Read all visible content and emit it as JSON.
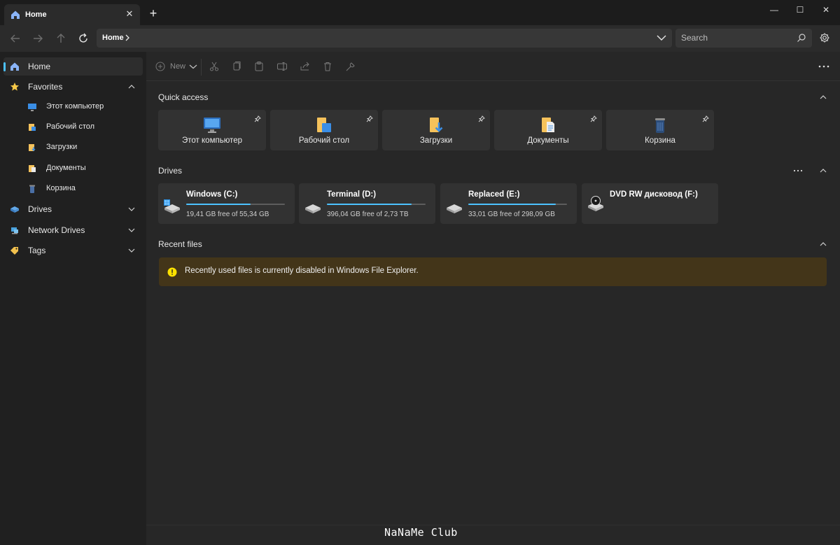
{
  "tab": {
    "title": "Home",
    "close": "✕",
    "new_tab": "+"
  },
  "window_controls": {
    "minimize": "—",
    "maximize": "☐",
    "close": "✕"
  },
  "address": {
    "crumb": "Home"
  },
  "search": {
    "placeholder": "Search"
  },
  "sidebar": {
    "items": [
      {
        "label": "Home",
        "icon": "home-icon",
        "active": true
      },
      {
        "label": "Favorites",
        "icon": "star-icon",
        "expanded": true
      },
      {
        "label": "Этот компьютер",
        "icon": "monitor-icon"
      },
      {
        "label": "Рабочий стол",
        "icon": "folder-icon"
      },
      {
        "label": "Загрузки",
        "icon": "folder-icon"
      },
      {
        "label": "Документы",
        "icon": "document-icon"
      },
      {
        "label": "Корзина",
        "icon": "recycle-bin-icon"
      },
      {
        "label": "Drives",
        "icon": "drive-icon",
        "expanded": false
      },
      {
        "label": "Network Drives",
        "icon": "network-icon",
        "expanded": false
      },
      {
        "label": "Tags",
        "icon": "tag-icon",
        "expanded": false
      }
    ]
  },
  "toolbar": {
    "new_label": "New"
  },
  "quick_access": {
    "title": "Quick access",
    "items": [
      {
        "label": "Этот компьютер",
        "icon": "monitor-icon"
      },
      {
        "label": "Рабочий стол",
        "icon": "desktop-folder-icon"
      },
      {
        "label": "Загрузки",
        "icon": "downloads-folder-icon"
      },
      {
        "label": "Документы",
        "icon": "documents-folder-icon"
      },
      {
        "label": "Корзина",
        "icon": "recycle-bin-icon"
      }
    ]
  },
  "drives": {
    "title": "Drives",
    "items": [
      {
        "name": "Windows (C:)",
        "free": "19,41 GB free of 55,34 GB",
        "used_fraction": 0.65
      },
      {
        "name": "Terminal (D:)",
        "free": "396,04 GB free of 2,73 TB",
        "used_fraction": 0.86
      },
      {
        "name": "Replaced (E:)",
        "free": "33,01 GB free of 298,09 GB",
        "used_fraction": 0.89
      },
      {
        "name": "DVD RW дисковод (F:)",
        "free": "",
        "used_fraction": null
      }
    ]
  },
  "recent": {
    "title": "Recent files",
    "message": "Recently used files is currently disabled in Windows File Explorer."
  },
  "watermark": "NaNaMe Club",
  "colors": {
    "accent": "#4cc2ff",
    "warning_bg": "#433519",
    "warning_icon": "#fce100"
  }
}
